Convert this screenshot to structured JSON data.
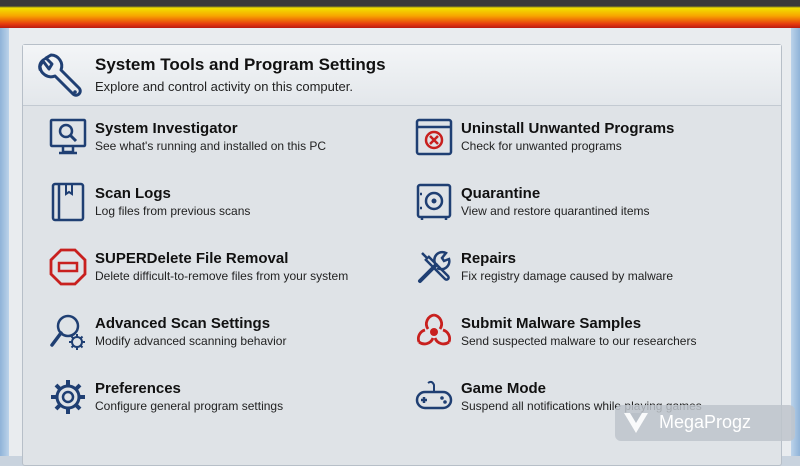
{
  "header": {
    "title": "System Tools and Program Settings",
    "subtitle": "Explore and control activity on this computer.",
    "icon": "wrench-icon"
  },
  "items": [
    {
      "title": "System Investigator",
      "desc": "See what's running and installed on this PC",
      "icon": "monitor-magnifier-icon"
    },
    {
      "title": "Uninstall Unwanted Programs",
      "desc": "Check for unwanted programs",
      "icon": "uninstall-window-icon"
    },
    {
      "title": "Scan Logs",
      "desc": "Log files from previous scans",
      "icon": "log-book-icon"
    },
    {
      "title": "Quarantine",
      "desc": "View and restore quarantined items",
      "icon": "vault-icon"
    },
    {
      "title": "SUPERDelete File Removal",
      "desc": "Delete difficult-to-remove files from your system",
      "icon": "stop-sign-icon"
    },
    {
      "title": "Repairs",
      "desc": "Fix registry damage caused by malware",
      "icon": "tools-icon"
    },
    {
      "title": "Advanced Scan Settings",
      "desc": "Modify advanced scanning behavior",
      "icon": "magnifier-gear-icon"
    },
    {
      "title": "Submit Malware Samples",
      "desc": "Send suspected malware to our researchers",
      "icon": "biohazard-icon"
    },
    {
      "title": "Preferences",
      "desc": "Configure general program settings",
      "icon": "gear-icon"
    },
    {
      "title": "Game Mode",
      "desc": "Suspend all notifications while playing games",
      "icon": "gamepad-icon"
    }
  ],
  "watermark": {
    "text": "MegaProgz"
  },
  "colors": {
    "icon_blue": "#1f3f73",
    "icon_red": "#c8201e",
    "panel_bg": "#dfe3e7"
  }
}
